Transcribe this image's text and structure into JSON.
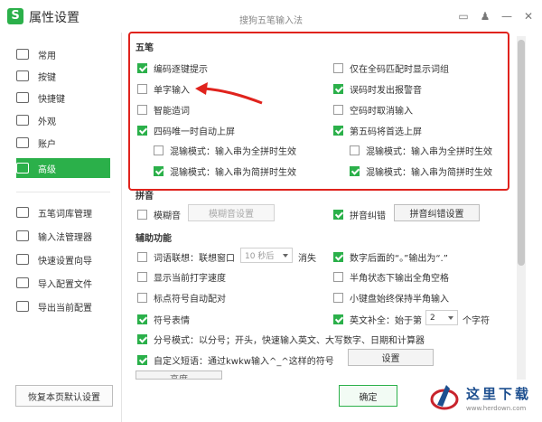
{
  "window": {
    "logo_text": "S",
    "title": "属性设置",
    "subtitle": "搜狗五笔输入法",
    "icons": [
      "feedback-icon",
      "shirt-icon",
      "minimize-icon",
      "close-icon"
    ]
  },
  "sidebar": {
    "items": [
      {
        "label": "常用",
        "icon": "monitor-icon"
      },
      {
        "label": "按键",
        "icon": "keyboard-icon"
      },
      {
        "label": "快捷键",
        "icon": "shortcut-icon"
      },
      {
        "label": "外观",
        "icon": "shirt-icon"
      },
      {
        "label": "账户",
        "icon": "user-icon"
      },
      {
        "label": "高级",
        "icon": "advanced-icon",
        "active": true
      },
      {
        "label": "五笔词库管理",
        "icon": "dictionary-icon"
      },
      {
        "label": "输入法管理器",
        "icon": "manager-icon"
      },
      {
        "label": "快速设置向导",
        "icon": "flag-icon"
      },
      {
        "label": "导入配置文件",
        "icon": "import-icon"
      },
      {
        "label": "导出当前配置",
        "icon": "export-icon"
      }
    ],
    "restore_button": "恢复本页默认设置"
  },
  "wubi": {
    "title": "五笔",
    "left": [
      {
        "label": "编码逐键提示",
        "checked": true
      },
      {
        "label": "单字输入",
        "checked": false
      },
      {
        "label": "智能造词",
        "checked": false
      },
      {
        "label": "四码唯一时自动上屏",
        "checked": true
      },
      {
        "label": "混输模式：输入串为全拼时生效",
        "checked": false
      },
      {
        "label": "混输模式：输入串为简拼时生效",
        "checked": true
      }
    ],
    "right": [
      {
        "label": "仅在全码匹配时显示词组",
        "checked": false
      },
      {
        "label": "误码时发出报警音",
        "checked": true
      },
      {
        "label": "空码时取消输入",
        "checked": false
      },
      {
        "label": "第五码将首选上屏",
        "checked": true
      },
      {
        "label": "混输模式：输入串为全拼时生效",
        "checked": false
      },
      {
        "label": "混输模式：输入串为简拼时生效",
        "checked": true
      }
    ]
  },
  "pinyin": {
    "title": "拼音",
    "fuzzy": {
      "label": "模糊音",
      "checked": false
    },
    "fuzzy_button": "模糊音设置",
    "correct": {
      "label": "拼音纠错",
      "checked": true
    },
    "correct_button": "拼音纠错设置"
  },
  "aux": {
    "title": "辅助功能",
    "association": {
      "label": "词语联想：联想窗口",
      "checked": false
    },
    "association_select": "10 秒后",
    "association_suffix": "消失",
    "digit_after": {
      "label": "数字后面的“。”输出为“.”",
      "checked": true
    },
    "show_speed": {
      "label": "显示当前打字速度",
      "checked": false
    },
    "halfwidth_space": {
      "label": "半角状态下输出全角空格",
      "checked": false
    },
    "punct_pair": {
      "label": "标点符号自动配对",
      "checked": false
    },
    "keypad_halfwidth": {
      "label": "小键盘始终保持半角输入",
      "checked": false
    },
    "emoji": {
      "label": "符号表情",
      "checked": true
    },
    "english_complete": {
      "label": "英文补全：始于第",
      "checked": true
    },
    "english_select": "2",
    "english_suffix": "个字符",
    "fenhao": {
      "label": "分号模式：以分号；开头，快速输入英文、大写数字、日期和计算器",
      "checked": true
    },
    "custom_phrase": {
      "label": "自定义短语：通过kwkw输入^_^这样的符号",
      "checked": true
    },
    "custom_button": "设置",
    "hidden_button": "高度"
  },
  "footer": {
    "ok_button": "确定"
  },
  "watermark": {
    "text": "这里下载",
    "url": "www.herdown.com"
  },
  "colors": {
    "accent": "#2bb04a",
    "annotation": "#e0231d"
  }
}
